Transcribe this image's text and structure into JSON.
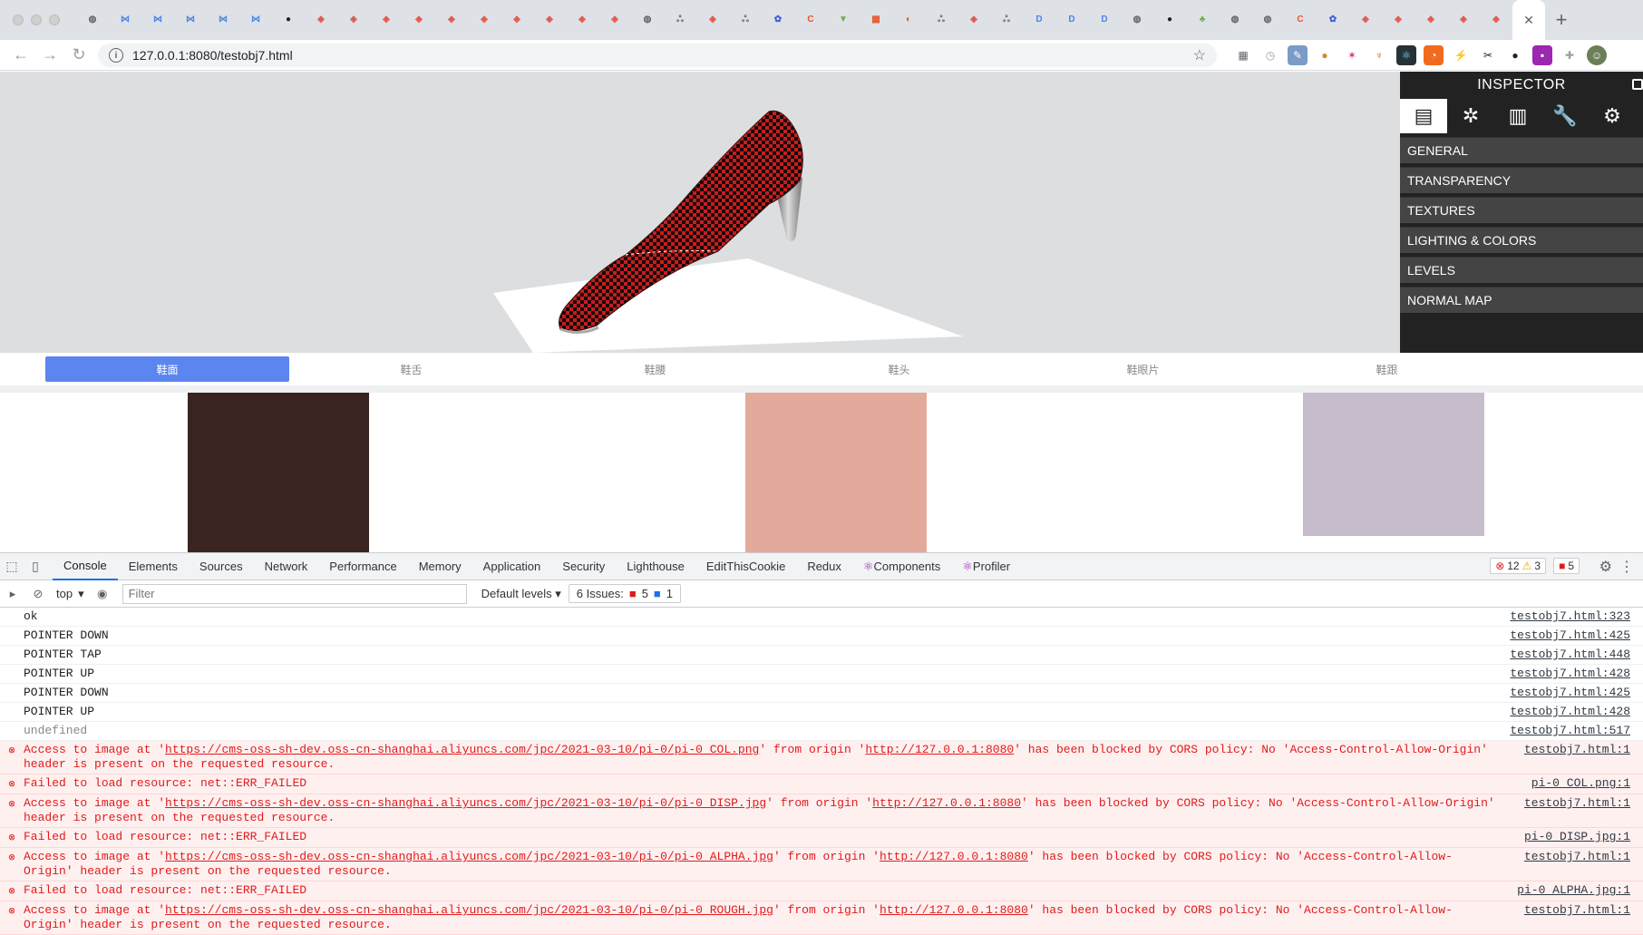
{
  "browser": {
    "tab_favicons": [
      {
        "icon": "globe-icon",
        "color": "#5f6368",
        "glyph": "◍"
      },
      {
        "icon": "bracket-icon",
        "color": "#4a86e8",
        "glyph": "⋈"
      },
      {
        "icon": "bracket-icon",
        "color": "#4a86e8",
        "glyph": "⋈"
      },
      {
        "icon": "bracket-icon",
        "color": "#4a86e8",
        "glyph": "⋈"
      },
      {
        "icon": "bracket-icon",
        "color": "#4a86e8",
        "glyph": "⋈"
      },
      {
        "icon": "bracket-icon",
        "color": "#4a86e8",
        "glyph": "⋈"
      },
      {
        "icon": "github-icon",
        "color": "#202124",
        "glyph": "●"
      },
      {
        "icon": "box-icon",
        "color": "#e0584a",
        "glyph": "◈"
      },
      {
        "icon": "box-icon",
        "color": "#e0584a",
        "glyph": "◈"
      },
      {
        "icon": "box-icon",
        "color": "#e0584a",
        "glyph": "◈"
      },
      {
        "icon": "box-icon",
        "color": "#e0584a",
        "glyph": "◈"
      },
      {
        "icon": "box-icon",
        "color": "#e0584a",
        "glyph": "◈"
      },
      {
        "icon": "box-icon",
        "color": "#e0584a",
        "glyph": "◈"
      },
      {
        "icon": "box-icon",
        "color": "#e0584a",
        "glyph": "◈"
      },
      {
        "icon": "box-icon",
        "color": "#e0584a",
        "glyph": "◈"
      },
      {
        "icon": "box-icon",
        "color": "#e0584a",
        "glyph": "◈"
      },
      {
        "icon": "box-icon",
        "color": "#e0584a",
        "glyph": "◈"
      },
      {
        "icon": "globe-icon",
        "color": "#5f6368",
        "glyph": "◍"
      },
      {
        "icon": "script-icon",
        "color": "#5f6368",
        "glyph": "ஃ"
      },
      {
        "icon": "box-icon",
        "color": "#e0584a",
        "glyph": "◈"
      },
      {
        "icon": "script-icon",
        "color": "#5f6368",
        "glyph": "ஃ"
      },
      {
        "icon": "paw-icon",
        "color": "#3b5bdb",
        "glyph": "✿"
      },
      {
        "icon": "c-icon",
        "color": "#e8552e",
        "glyph": "C"
      },
      {
        "icon": "funnel-icon",
        "color": "#6ab04c",
        "glyph": "▼"
      },
      {
        "icon": "calendar-icon",
        "color": "#e8552e",
        "glyph": "▦"
      },
      {
        "icon": "swirl-icon",
        "color": "#e8552e",
        "glyph": "◐"
      },
      {
        "icon": "script-icon",
        "color": "#5f6368",
        "glyph": "ஃ"
      },
      {
        "icon": "box-icon",
        "color": "#e0584a",
        "glyph": "◈"
      },
      {
        "icon": "script-icon",
        "color": "#5f6368",
        "glyph": "ஃ"
      },
      {
        "icon": "d-icon",
        "color": "#4a86e8",
        "glyph": "D"
      },
      {
        "icon": "d-icon",
        "color": "#4a86e8",
        "glyph": "D"
      },
      {
        "icon": "d-icon",
        "color": "#4a86e8",
        "glyph": "D"
      },
      {
        "icon": "globe-icon",
        "color": "#5f6368",
        "glyph": "◍"
      },
      {
        "icon": "github-icon",
        "color": "#202124",
        "glyph": "●"
      },
      {
        "icon": "tree-icon",
        "color": "#6ab04c",
        "glyph": "♣"
      },
      {
        "icon": "globe-icon",
        "color": "#5f6368",
        "glyph": "◍"
      },
      {
        "icon": "globe-icon",
        "color": "#5f6368",
        "glyph": "◍"
      },
      {
        "icon": "c-icon",
        "color": "#e8552e",
        "glyph": "C"
      },
      {
        "icon": "paw-icon",
        "color": "#3b5bdb",
        "glyph": "✿"
      },
      {
        "icon": "box-icon",
        "color": "#e0584a",
        "glyph": "◈"
      },
      {
        "icon": "box-icon",
        "color": "#e0584a",
        "glyph": "◈"
      },
      {
        "icon": "box-icon",
        "color": "#e0584a",
        "glyph": "◈"
      },
      {
        "icon": "box-icon",
        "color": "#e0584a",
        "glyph": "◈"
      },
      {
        "icon": "box-icon",
        "color": "#e0584a",
        "glyph": "◈"
      }
    ],
    "active_tab_close": "✕",
    "new_tab": "+",
    "url": "127.0.0.1:8080/testobj7.html"
  },
  "inspector": {
    "title": "INSPECTOR",
    "icons": [
      "document-icon",
      "bug-icon",
      "chart-icon",
      "wrench-icon",
      "gear-icon"
    ],
    "sections": [
      "GENERAL",
      "TRANSPARENCY",
      "TEXTURES",
      "LIGHTING & COLORS",
      "LEVELS",
      "NORMAL MAP"
    ]
  },
  "parts": [
    "鞋面",
    "鞋舌",
    "鞋腰",
    "鞋头",
    "鞋眼片",
    "鞋跟"
  ],
  "selected_part": 0,
  "swatch_colors": [
    "#3a2420",
    "#e3aa9b",
    "#c7bccb"
  ],
  "devtools": {
    "tabs": [
      "Console",
      "Elements",
      "Sources",
      "Network",
      "Performance",
      "Memory",
      "Application",
      "Security",
      "Lighthouse",
      "EditThisCookie",
      "Redux",
      "Components",
      "Profiler"
    ],
    "selected_tab": "Console",
    "counts": {
      "errors": "12",
      "warnings": "3",
      "issues": "5"
    },
    "context": "top",
    "filter_placeholder": "Filter",
    "levels": "Default levels",
    "issues_label": "6 Issues:",
    "issues_errors": "5",
    "issues_info": "1"
  },
  "console": [
    {
      "type": "log",
      "msg": "ok",
      "src": "testobj7.html:323"
    },
    {
      "type": "log",
      "msg": "POINTER DOWN",
      "src": "testobj7.html:425"
    },
    {
      "type": "log",
      "msg": "POINTER TAP",
      "src": "testobj7.html:448"
    },
    {
      "type": "log",
      "msg": "POINTER UP",
      "src": "testobj7.html:428"
    },
    {
      "type": "log",
      "msg": "POINTER DOWN",
      "src": "testobj7.html:425"
    },
    {
      "type": "log",
      "msg": "POINTER UP",
      "src": "testobj7.html:428"
    },
    {
      "type": "undef",
      "msg": "undefined",
      "src": "testobj7.html:517"
    },
    {
      "type": "err",
      "pre": "Access to image at '",
      "url": "https://cms-oss-sh-dev.oss-cn-shanghai.aliyuncs.com/jpc/2021-03-10/pi-0/pi-0_COL.png",
      "mid": "' from origin '",
      "origin": "http://127.0.0.1:8080",
      "post": "' has been blocked by CORS policy: No 'Access-Control-Allow-Origin' header is present on the requested resource.",
      "src": "testobj7.html:1"
    },
    {
      "type": "err",
      "msg": "Failed to load resource: net::ERR_FAILED",
      "src": "pi-0_COL.png:1"
    },
    {
      "type": "err",
      "pre": "Access to image at '",
      "url": "https://cms-oss-sh-dev.oss-cn-shanghai.aliyuncs.com/jpc/2021-03-10/pi-0/pi-0_DISP.jpg",
      "mid": "' from origin '",
      "origin": "http://127.0.0.1:8080",
      "post": "' has been blocked by CORS policy: No 'Access-Control-Allow-Origin' header is present on the requested resource.",
      "src": "testobj7.html:1"
    },
    {
      "type": "err",
      "msg": "Failed to load resource: net::ERR_FAILED",
      "src": "pi-0_DISP.jpg:1"
    },
    {
      "type": "err",
      "pre": "Access to image at '",
      "url": "https://cms-oss-sh-dev.oss-cn-shanghai.aliyuncs.com/jpc/2021-03-10/pi-0/pi-0_ALPHA.jpg",
      "mid": "' from origin '",
      "origin": "http://127.0.0.1:8080",
      "post": "' has been blocked by CORS policy: No 'Access-Control-Allow-Origin' header is present on the requested resource.",
      "src": "testobj7.html:1"
    },
    {
      "type": "err",
      "msg": "Failed to load resource: net::ERR_FAILED",
      "src": "pi-0_ALPHA.jpg:1"
    },
    {
      "type": "err",
      "pre": "Access to image at '",
      "url": "https://cms-oss-sh-dev.oss-cn-shanghai.aliyuncs.com/jpc/2021-03-10/pi-0/pi-0_ROUGH.jpg",
      "mid": "' from origin '",
      "origin": "http://127.0.0.1:8080",
      "post": "' has been blocked by CORS policy: No 'Access-Control-Allow-Origin' header is present on the requested resource.",
      "src": "testobj7.html:1"
    }
  ]
}
